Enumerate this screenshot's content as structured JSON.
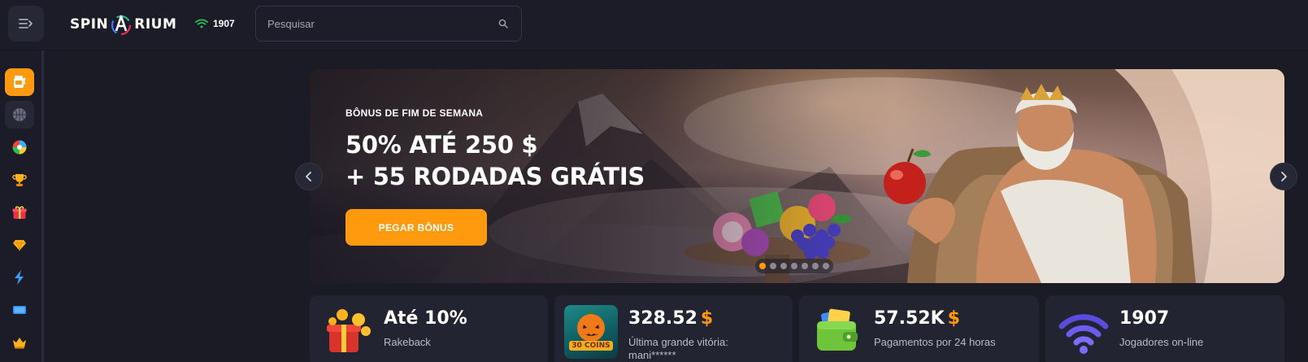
{
  "header": {
    "menu_icon": "menu-arrow-icon",
    "logo_left": "SPIN",
    "logo_right": "RIUM",
    "online_icon": "wifi-icon",
    "online_count": "1907",
    "search": {
      "placeholder": "Pesquisar",
      "icon": "search-icon"
    }
  },
  "sidebar": {
    "items": [
      {
        "name": "slots",
        "icon": "slot-machine-icon",
        "active": true
      },
      {
        "name": "sports",
        "icon": "basketball-icon"
      },
      {
        "name": "live",
        "icon": "roulette-icon"
      },
      {
        "name": "tournaments",
        "icon": "trophy-icon"
      },
      {
        "name": "bonuses",
        "icon": "gift-icon"
      },
      {
        "name": "vip",
        "icon": "gem-icon"
      },
      {
        "name": "fast-games",
        "icon": "lightning-icon"
      },
      {
        "name": "tv",
        "icon": "screen-icon"
      },
      {
        "name": "loyalty",
        "icon": "crown-icon"
      }
    ]
  },
  "banner": {
    "eyebrow": "BÔNUS DE FIM DE SEMANA",
    "line1": "50% ATÉ 250 $",
    "line2": "+ 55 RODADAS GRÁTIS",
    "cta": "PEGAR BÔNUS",
    "slide_count": 7,
    "active_slide": 1
  },
  "stats": [
    {
      "value": "Até 10%",
      "currency": "",
      "label": "Rakeback",
      "icon": "gift-coins-icon"
    },
    {
      "value": "328.52",
      "currency": "$",
      "label": "Última grande vitória:",
      "label2": "mani******",
      "thumb_text": "30 COINS"
    },
    {
      "value": "57.52K",
      "currency": "$",
      "label": "Pagamentos por 24 horas",
      "icon": "wallet-icon"
    },
    {
      "value": "1907",
      "currency": "",
      "label": "Jogadores on-line",
      "icon": "wifi-icon"
    }
  ],
  "colors": {
    "accent": "#ff9a0e",
    "background": "#1a1b25",
    "card": "#232432",
    "online_green": "#2fbf5a"
  }
}
